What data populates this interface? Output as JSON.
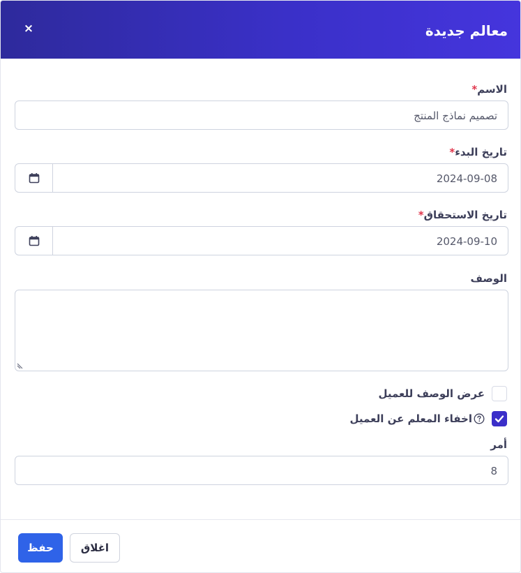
{
  "modal": {
    "title": "معالم جديدة",
    "close_glyph": "×"
  },
  "form": {
    "name": {
      "label": "الاسم",
      "required_mark": "*",
      "value": "تصميم نماذج المنتج"
    },
    "start_date": {
      "label": "تاريخ البدء",
      "required_mark": "*",
      "value": "2024-09-08",
      "icon": "calendar-icon"
    },
    "due_date": {
      "label": "تاريخ الاستحقاق",
      "required_mark": "*",
      "value": "2024-09-10",
      "icon": "calendar-icon"
    },
    "description": {
      "label": "الوصف",
      "value": ""
    },
    "show_description": {
      "label": "عرض الوصف للعميل",
      "checked": false
    },
    "hide_milestone": {
      "label": "اخفاء المعلم عن العميل",
      "checked": true,
      "icon": "help-circle-icon"
    },
    "order": {
      "label": "أمر",
      "value": "8"
    }
  },
  "footer": {
    "save_label": "حفظ",
    "close_label": "اغلاق"
  },
  "colors": {
    "header_gradient_start": "#2e2a9c",
    "header_gradient_end": "#4535dd",
    "primary": "#2f63e8",
    "checkbox_checked": "#3b2fc9",
    "required": "#e0364c"
  }
}
